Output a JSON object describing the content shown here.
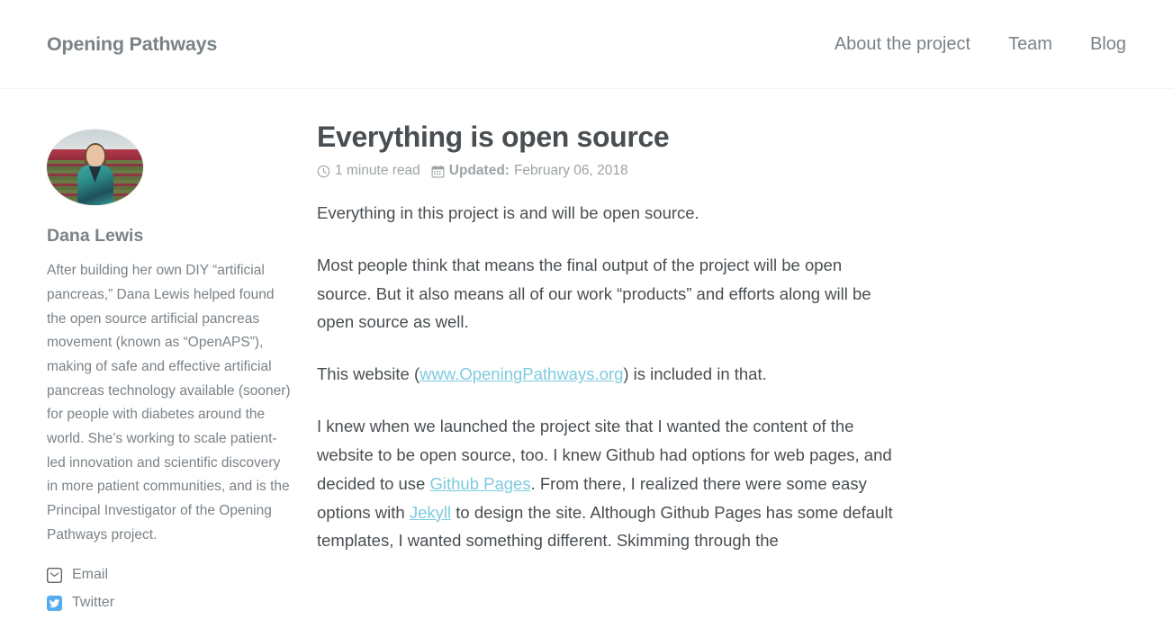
{
  "masthead": {
    "site_title": "Opening Pathways",
    "nav": [
      {
        "label": "About the project",
        "name": "nav-about"
      },
      {
        "label": "Team",
        "name": "nav-team"
      },
      {
        "label": "Blog",
        "name": "nav-blog"
      }
    ]
  },
  "sidebar": {
    "avatar_alt": "Dana Lewis standing in a field of tulips",
    "author_name": "Dana Lewis",
    "author_bio": "After building her own DIY “artificial pancreas,” Dana Lewis helped found the open source artificial pancreas movement (known as “OpenAPS”), making of safe and effective artificial pancreas technology available (sooner) for people with diabetes around the world. She’s working to scale patient-led innovation and scientific discovery in more patient communities, and is the Principal Investigator of the Opening Pathways project.",
    "links": [
      {
        "label": "Email",
        "icon": "envelope-icon",
        "name": "author-link-email"
      },
      {
        "label": "Twitter",
        "icon": "twitter-icon",
        "name": "author-link-twitter"
      }
    ]
  },
  "article": {
    "title": "Everything is open source",
    "meta": {
      "read_time": "1 minute read",
      "updated_label": "Updated:",
      "updated_date": "February 06, 2018",
      "clock_icon": "clock-icon",
      "calendar_icon": "calendar-icon"
    },
    "paragraphs": {
      "p1": "Everything in this project is and will be open source.",
      "p2": "Most people think that means the final output of the project will be open source. But it also means all of our work “products” and efforts along will be open source as well.",
      "p3_pre": "This website (",
      "p3_link": "www.OpeningPathways.org",
      "p3_post": ") is included in that.",
      "p4_a": "I knew when we launched the project site that I wanted the content of the website to be open source, too. I knew Github had options for web pages, and decided to use ",
      "p4_link1": "Github Pages",
      "p4_b": ". From there, I realized there were some easy options with ",
      "p4_link2": "Jekyll",
      "p4_c": " to design the site. Although Github Pages has some default templates, I wanted something different. Skimming through the"
    }
  },
  "colors": {
    "text_dark": "#494e52",
    "text_muted": "#7a8288",
    "meta_gray": "#9da3a6",
    "link_blue": "#7ecbe0",
    "twitter_blue": "#55acee",
    "border": "#f2f3f3"
  }
}
